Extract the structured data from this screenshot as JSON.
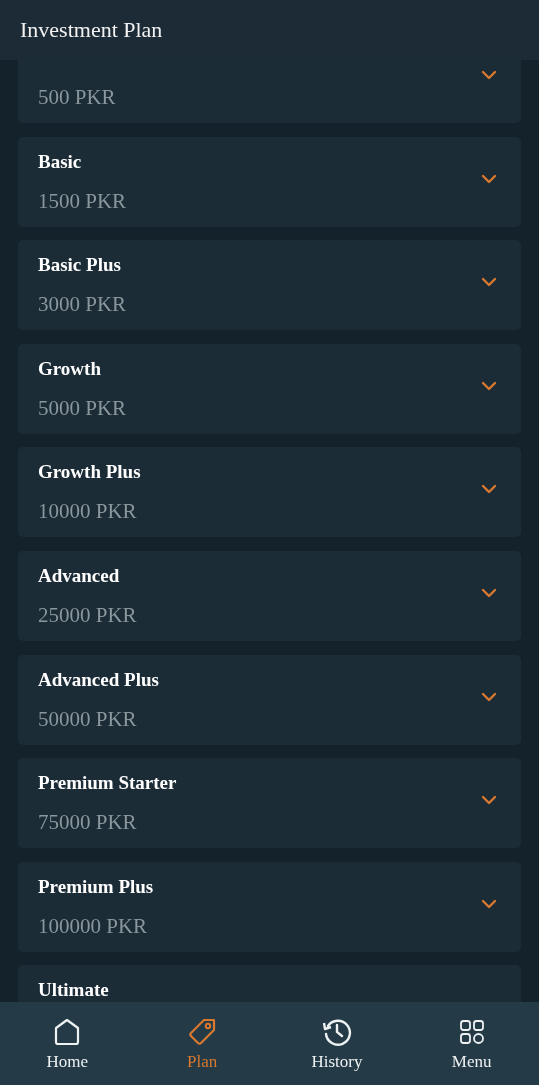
{
  "header": {
    "title": "Investment Plan"
  },
  "plans": [
    {
      "price": "500 PKR",
      "expanded": false
    },
    {
      "name": "Basic",
      "price": "1500 PKR",
      "expanded": false
    },
    {
      "name": "Basic Plus",
      "price": "3000 PKR",
      "expanded": false
    },
    {
      "name": "Growth",
      "price": "5000 PKR",
      "expanded": false
    },
    {
      "name": "Growth Plus",
      "price": "10000 PKR",
      "expanded": false
    },
    {
      "name": "Advanced",
      "price": "25000 PKR",
      "expanded": false
    },
    {
      "name": "Advanced Plus",
      "price": "50000 PKR",
      "expanded": false
    },
    {
      "name": "Premium Starter",
      "price": "75000 PKR",
      "expanded": false
    },
    {
      "name": "Premium Plus",
      "price": "100000 PKR",
      "expanded": false
    },
    {
      "name": "Ultimate"
    }
  ],
  "nav": [
    {
      "kind": "home",
      "label": "Home",
      "selected": false
    },
    {
      "kind": "plan",
      "label": "Plan",
      "selected": true
    },
    {
      "kind": "history",
      "label": "History",
      "selected": false
    },
    {
      "kind": "menu",
      "label": "Menu",
      "selected": false
    }
  ]
}
